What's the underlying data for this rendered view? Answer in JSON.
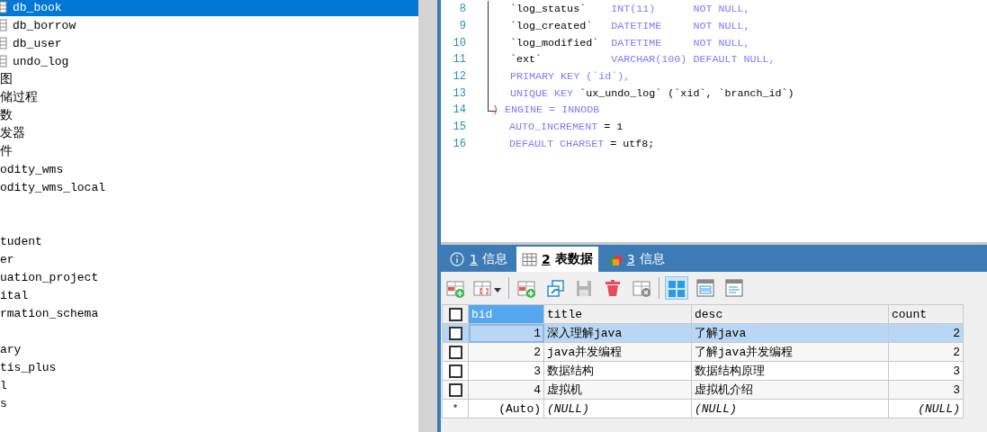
{
  "tree": {
    "sections": [
      [
        {
          "kind": "table",
          "label": "db_book",
          "selected": true
        },
        {
          "kind": "table",
          "label": "db_borrow",
          "selected": false
        },
        {
          "kind": "table",
          "label": "db_user",
          "selected": false
        },
        {
          "kind": "table",
          "label": "undo_log",
          "selected": false
        },
        {
          "kind": "node",
          "label": "图",
          "selected": false
        },
        {
          "kind": "node",
          "label": "储过程",
          "selected": false
        },
        {
          "kind": "node",
          "label": "数",
          "selected": false
        },
        {
          "kind": "node",
          "label": "发器",
          "selected": false
        },
        {
          "kind": "node",
          "label": "件",
          "selected": false
        },
        {
          "kind": "node",
          "label": "odity_wms",
          "selected": false
        },
        {
          "kind": "node",
          "label": "odity_wms_local",
          "selected": false
        }
      ],
      [
        {
          "kind": "node",
          "label": "tudent",
          "selected": false
        },
        {
          "kind": "node",
          "label": "er",
          "selected": false
        },
        {
          "kind": "node",
          "label": "uation_project",
          "selected": false
        },
        {
          "kind": "node",
          "label": "ital",
          "selected": false
        },
        {
          "kind": "node",
          "label": "rmation_schema",
          "selected": false
        }
      ],
      [
        {
          "kind": "node",
          "label": "ary",
          "selected": false
        },
        {
          "kind": "node",
          "label": "tis_plus",
          "selected": false
        },
        {
          "kind": "node",
          "label": "l",
          "selected": false
        },
        {
          "kind": "node",
          "label": "s",
          "selected": false
        }
      ]
    ]
  },
  "editor": {
    "lines": [
      {
        "number": "8",
        "tokens": [
          {
            "kind": "ident",
            "text": "`log_status`    "
          },
          {
            "kind": "keyword",
            "text": "INT(11)      NOT NULL,"
          }
        ]
      },
      {
        "number": "9",
        "tokens": [
          {
            "kind": "ident",
            "text": "`log_created`   "
          },
          {
            "kind": "keyword",
            "text": "DATETIME     NOT NULL,"
          }
        ]
      },
      {
        "number": "10",
        "tokens": [
          {
            "kind": "ident",
            "text": "`log_modified`  "
          },
          {
            "kind": "keyword",
            "text": "DATETIME     NOT NULL,"
          }
        ]
      },
      {
        "number": "11",
        "tokens": [
          {
            "kind": "ident",
            "text": "`ext`           "
          },
          {
            "kind": "keyword",
            "text": "VARCHAR(100) DEFAULT NULL,"
          }
        ]
      },
      {
        "number": "12",
        "tokens": [
          {
            "kind": "keyword",
            "text": "PRIMARY KEY (`id`),"
          }
        ]
      },
      {
        "number": "13",
        "tokens": [
          {
            "kind": "keyword",
            "text": "UNIQUE KEY"
          },
          {
            "kind": "ident",
            "text": " `ux_undo_log` (`xid`, `branch_id`)"
          }
        ]
      },
      {
        "number": "14",
        "tokens": [
          {
            "kind": "paren",
            "text": ")"
          },
          {
            "kind": "keyword",
            "text": " ENGINE = INNODB"
          }
        ]
      },
      {
        "number": "15",
        "tokens": [
          {
            "kind": "keyword",
            "text": "AUTO_INCREMENT"
          },
          {
            "kind": "ident",
            "text": " = 1"
          }
        ]
      },
      {
        "number": "16",
        "tokens": [
          {
            "kind": "keyword",
            "text": "DEFAULT CHARSET"
          },
          {
            "kind": "ident",
            "text": " = utf8;"
          }
        ]
      }
    ]
  },
  "result_tabs": [
    {
      "kind": "info",
      "key": "1",
      "label": "信息",
      "selected": false
    },
    {
      "kind": "grid",
      "key": "2",
      "label": "表数据",
      "selected": true
    },
    {
      "kind": "shapes",
      "key": "3",
      "label": "信息",
      "selected": false
    }
  ],
  "toolbar": [
    {
      "kind": "add-row",
      "selected": false
    },
    {
      "kind": "filter",
      "selected": false
    },
    {
      "kind": "sep"
    },
    {
      "kind": "add-row",
      "selected": false
    },
    {
      "kind": "import",
      "selected": false
    },
    {
      "kind": "save",
      "selected": false
    },
    {
      "kind": "delete",
      "selected": false
    },
    {
      "kind": "cancel",
      "selected": false
    },
    {
      "kind": "sep"
    },
    {
      "kind": "grid-view",
      "selected": true
    },
    {
      "kind": "form-view",
      "selected": false
    },
    {
      "kind": "text-view",
      "selected": false
    }
  ],
  "table": {
    "all_checked": false,
    "columns": [
      {
        "label": "bid",
        "selected": true,
        "kind": "number"
      },
      {
        "label": "title",
        "selected": false,
        "kind": "text"
      },
      {
        "label": "desc",
        "selected": false,
        "kind": "text"
      },
      {
        "label": "count",
        "selected": false,
        "kind": "number"
      }
    ],
    "rows": [
      {
        "kind": "data",
        "selected": true,
        "checked": false,
        "cells": [
          "1",
          "深入理解java",
          "了解java",
          "2"
        ]
      },
      {
        "kind": "data",
        "selected": false,
        "checked": false,
        "cells": [
          "2",
          "java并发编程",
          "了解java并发编程",
          "2"
        ]
      },
      {
        "kind": "data",
        "selected": false,
        "checked": false,
        "cells": [
          "3",
          "数据结构",
          "数据结构原理",
          "3"
        ]
      },
      {
        "kind": "data",
        "selected": false,
        "checked": false,
        "cells": [
          "4",
          "虚拟机",
          "虚拟机介绍",
          "3"
        ]
      },
      {
        "kind": "new",
        "marker": "*",
        "selected": false,
        "cells": [
          "(Auto)",
          "(NULL)",
          "(NULL)",
          "(NULL)"
        ]
      }
    ]
  }
}
